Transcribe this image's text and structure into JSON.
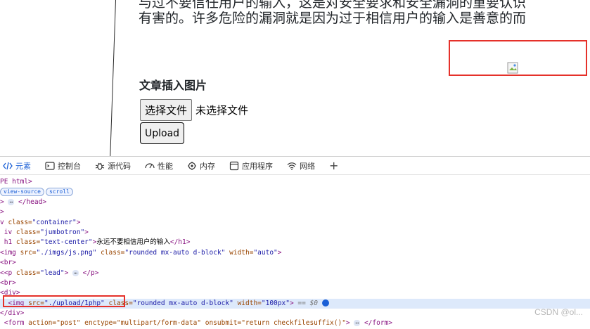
{
  "page": {
    "lead_line1": "与过不要信任用户的输入，这是对安全要求和安全漏洞的重要认识",
    "lead_line2": "有害的。许多危险的漏洞就是因为过于相信用户的输入是善意的而",
    "section_title": "文章插入图片",
    "file_button": "选择文件",
    "file_status": "未选择文件",
    "upload_button": "Upload"
  },
  "devtools": {
    "tabs": [
      {
        "label": "元素",
        "icon": "elements-icon",
        "active": true
      },
      {
        "label": "控制台",
        "icon": "console-icon"
      },
      {
        "label": "源代码",
        "icon": "sources-bug-icon"
      },
      {
        "label": "性能",
        "icon": "performance-icon"
      },
      {
        "label": "内存",
        "icon": "memory-icon"
      },
      {
        "label": "应用程序",
        "icon": "application-icon"
      },
      {
        "label": "网络",
        "icon": "network-wifi-icon"
      }
    ],
    "add_tab": "+",
    "lines": {
      "l1": "PE html>",
      "chip_view_source": "view-source",
      "chip_scroll": "scroll",
      "ellipsis": "⋯",
      "head_close": "</head>",
      "l4": ">",
      "container_tag": "<div",
      "container_attr": "class=",
      "container_val": "\"container\"",
      "jumbo_tag": "iv",
      "jumbo_attr": "class=",
      "jumbo_val": "\"jumbotron\"",
      "h1_open": "h1",
      "h1_attr": "class=",
      "h1_val": "\"text-center\"",
      "h1_text": "永远不要相信用户的输入",
      "h1_close": "</h1>",
      "img1_tag": "img",
      "img1_src_attr": "src=",
      "img1_src_val": "\"./imgs/js.png\"",
      "img1_class_attr": "class=",
      "img1_class_val": "\"rounded mx-auto d-block\"",
      "img1_width_attr": "width=",
      "img1_width_val": "\"auto\"",
      "br1": "br>",
      "p_tag": "<p",
      "p_attr": "class=",
      "p_val": "\"lead\"",
      "p_close": "</p>",
      "br2": "br>",
      "div_open": "div>",
      "img2_tag": "<img",
      "img2_src_attr": "src=",
      "img2_src_val": "\"./upload/1php\"",
      "img2_class_attr": "class=",
      "img2_class_val": "\"rounded mx-auto d-block\"",
      "img2_width_attr": "width=",
      "img2_width_val": "\"100px\"",
      "img2_eq": "== $0",
      "div_close": "</div>",
      "form_tag": "<form",
      "form_attrs": "action=\"post\" enctype=\"multipart/form-data\" onsubmit=\"return checkfilesuffix()\"",
      "form_close": "</form>"
    }
  },
  "watermark": "CSDN @ol..."
}
